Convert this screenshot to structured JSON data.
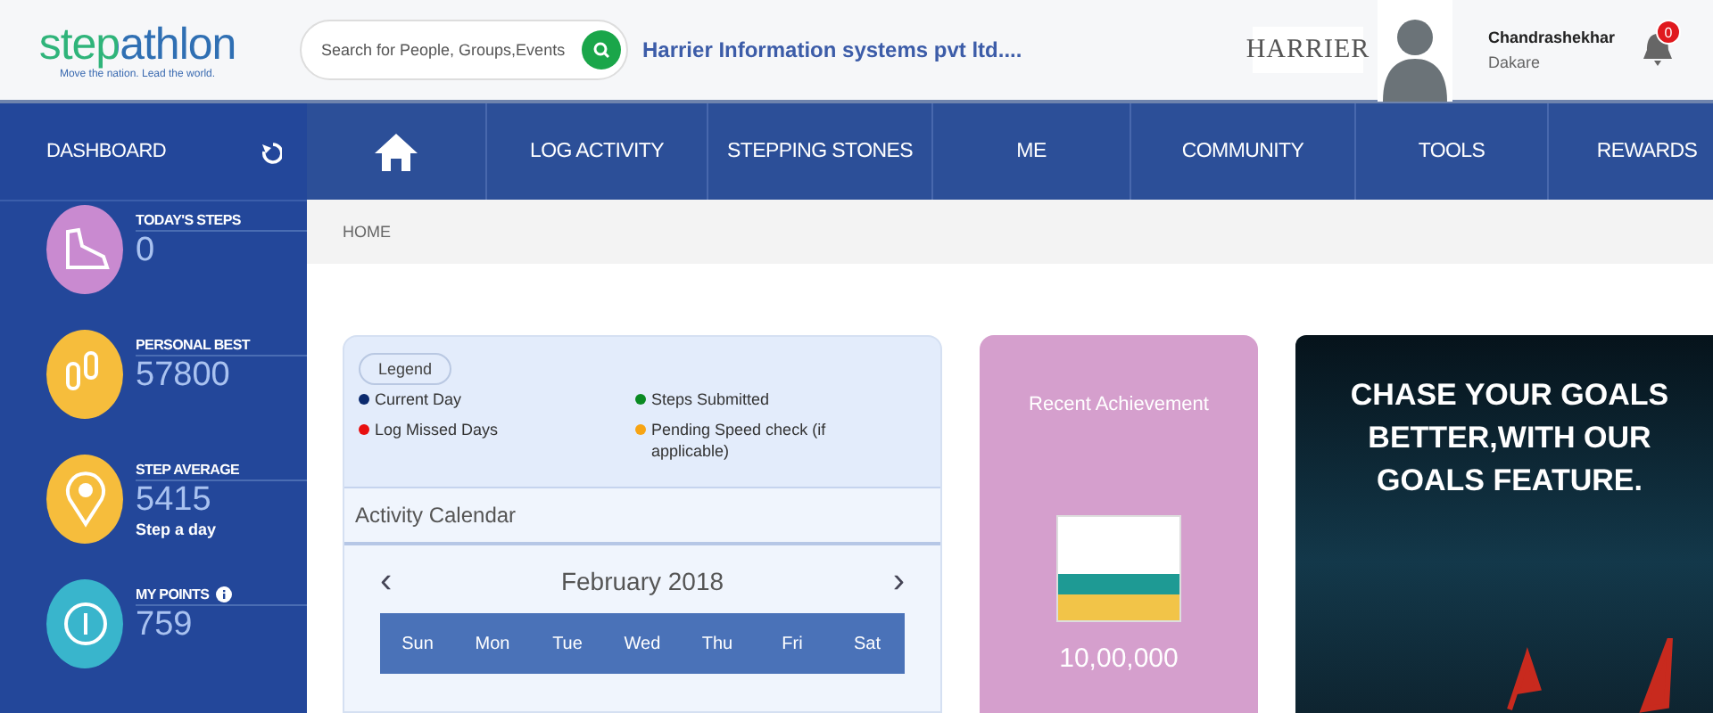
{
  "logo": {
    "text": "stepathlon",
    "tagline": "Move the nation. Lead the world."
  },
  "search": {
    "placeholder": "Search for People, Groups,Events"
  },
  "company": "Harrier Information systems pvt ltd....",
  "brand_logo": "HARRIER",
  "user": {
    "name": "Chandrashekhar",
    "surname": "Dakare"
  },
  "notifications": {
    "count": "0"
  },
  "sidebar": {
    "title": "DASHBOARD",
    "stats": [
      {
        "kind": "shoe",
        "label": "TODAY'S STEPS",
        "value": "0",
        "color": "#c98ad0"
      },
      {
        "kind": "footprints",
        "label": "PERSONAL BEST",
        "value": "57800",
        "color": "#f6bd3c"
      },
      {
        "kind": "pin",
        "label": "STEP AVERAGE",
        "value": "5415",
        "note": "Step a day",
        "color": "#f6bd3c"
      },
      {
        "kind": "coin",
        "label": "MY POINTS",
        "value": "759",
        "info": true,
        "color": "#39b5cc"
      }
    ]
  },
  "nav": [
    {
      "kind": "home"
    },
    {
      "kind": "text",
      "label": "LOG ACTIVITY"
    },
    {
      "kind": "text",
      "label": "STEPPING STONES"
    },
    {
      "kind": "text",
      "label": "ME"
    },
    {
      "kind": "text",
      "label": "COMMUNITY"
    },
    {
      "kind": "text",
      "label": "TOOLS"
    },
    {
      "kind": "text",
      "label": "REWARDS"
    }
  ],
  "breadcrumb": "HOME",
  "legend": {
    "title": "Legend",
    "items": [
      {
        "label": "Current Day",
        "color": "#0b2a6e"
      },
      {
        "label": "Steps Submitted",
        "color": "#0a8a22"
      },
      {
        "label": "Log Missed Days",
        "color": "#e80f0f"
      },
      {
        "label": "Pending Speed check (if applicable)",
        "color": "#f7a413"
      }
    ]
  },
  "calendar": {
    "title": "Activity Calendar",
    "month": "February 2018",
    "prev": "‹",
    "next": "›",
    "weekdays": [
      "Sun",
      "Mon",
      "Tue",
      "Wed",
      "Thu",
      "Fri",
      "Sat"
    ]
  },
  "achievement": {
    "title": "Recent Achievement",
    "value": "10,00,000"
  },
  "banner": {
    "lines": [
      "CHASE YOUR GOALS",
      "BETTER,WITH OUR",
      "GOALS FEATURE."
    ]
  }
}
